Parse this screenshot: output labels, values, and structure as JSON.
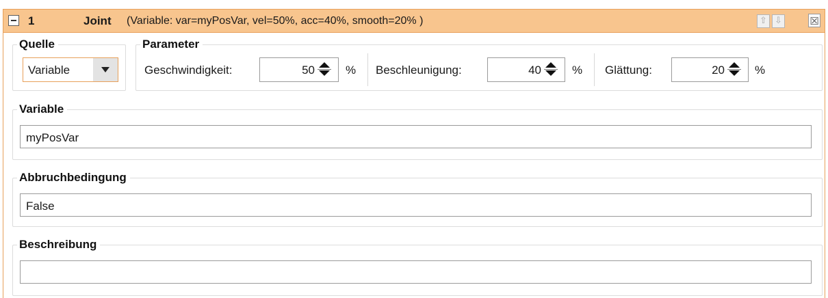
{
  "header": {
    "index": "1",
    "type": "Joint",
    "description": "(Variable: var=myPosVar, vel=50%, acc=40%, smooth=20% )",
    "up_icon": "⇧",
    "down_icon": "⇩",
    "close_icon": "☒"
  },
  "source": {
    "legend": "Quelle",
    "selected": "Variable"
  },
  "parameters": {
    "legend": "Parameter",
    "velocity": {
      "label": "Geschwindigkeit:",
      "value": "50",
      "unit": "%"
    },
    "acceleration": {
      "label": "Beschleunigung:",
      "value": "40",
      "unit": "%"
    },
    "smoothing": {
      "label": "Glättung:",
      "value": "20",
      "unit": "%"
    }
  },
  "variable": {
    "legend": "Variable",
    "value": "myPosVar"
  },
  "abort_condition": {
    "legend": "Abbruchbedingung",
    "value": "False"
  },
  "description": {
    "legend": "Beschreibung",
    "value": ""
  },
  "colors": {
    "header_bg": "#f8c58e",
    "accent_border": "#e8a05a"
  }
}
